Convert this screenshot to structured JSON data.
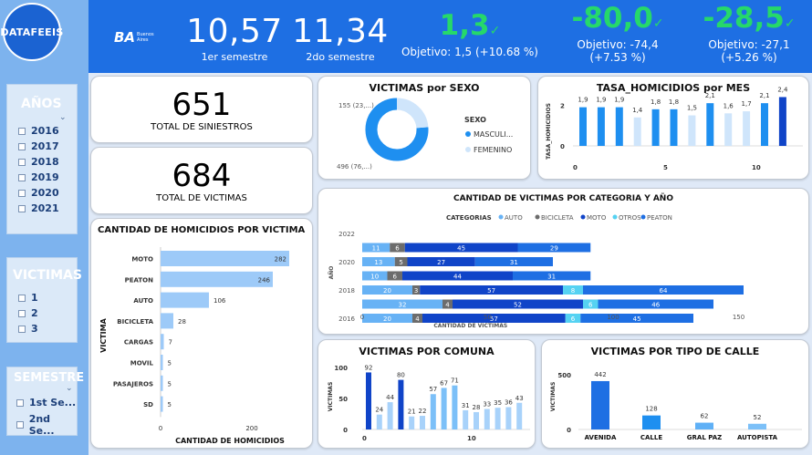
{
  "brand": {
    "logo_text": "DATAFEEIS",
    "ba_mark": "BA",
    "ba_caption": "Buenos Aires"
  },
  "colors": {
    "primary": "#1e6fe3",
    "accent_green": "#26d86a",
    "sidebar": "#7db3ee",
    "auto": "#67b2f5",
    "bicicleta": "#6c6c6c",
    "moto": "#1044c8",
    "otros": "#55d2f2",
    "peaton": "#1e6fe3"
  },
  "filters": {
    "years": {
      "title": "AÑOS",
      "items": [
        "2016",
        "2017",
        "2018",
        "2019",
        "2020",
        "2021"
      ]
    },
    "victims": {
      "title": "VICTIMAS",
      "items": [
        "1",
        "2",
        "3"
      ]
    },
    "semester": {
      "title": "SEMESTRE",
      "items": [
        "1st Se...",
        "2nd Se..."
      ]
    }
  },
  "kpis": {
    "sem1": {
      "value": "10,57",
      "label": "1er semestre"
    },
    "sem2": {
      "value": "11,34",
      "label": "2do semestre"
    },
    "k1": {
      "value": "1,3",
      "objective": "Objetivo: 1,5 (+10.68 %)"
    },
    "k2": {
      "value": "-80,0",
      "objective_line1": "Objetivo: -74,4",
      "objective_line2": "(+7.53 %)"
    },
    "k3": {
      "value": "-28,5",
      "objective_line1": "Objetivo: -27,1",
      "objective_line2": "(+5.26 %)"
    }
  },
  "totals": {
    "siniestros": {
      "value": "651",
      "label": "TOTAL DE SINIESTROS"
    },
    "victimas": {
      "value": "684",
      "label": "TOTAL DE VICTIMAS"
    }
  },
  "chart_data": [
    {
      "id": "sexo",
      "type": "pie",
      "title": "VICTIMAS por SEXO",
      "legend_title": "SEXO",
      "legend_placement": "right",
      "slices": [
        {
          "name": "MASCULI...",
          "value": 496,
          "label": "496 (76,...)",
          "color": "#1e8ff0"
        },
        {
          "name": "FEMENINO",
          "value": 155,
          "label": "155 (23,...)",
          "color": "#cfe5fb"
        }
      ]
    },
    {
      "id": "tasa",
      "type": "bar",
      "title": "TASA_HOMICIDIOS por MES",
      "ylabel": "TASA_HOMICIDIOS",
      "ylim": [
        0,
        2.6
      ],
      "y_ticks": [
        "0",
        "2"
      ],
      "x_ticks": [
        "0",
        "5",
        "10"
      ],
      "categories": [
        1,
        2,
        3,
        4,
        5,
        6,
        7,
        8,
        9,
        10,
        11,
        12
      ],
      "values": [
        1.9,
        1.9,
        1.9,
        1.4,
        1.8,
        1.8,
        1.5,
        2.1,
        1.6,
        1.7,
        2.1,
        2.4
      ],
      "labels": [
        "1,9",
        "1,9",
        "1,9",
        "1,4",
        "1,8",
        "1,8",
        "1,5",
        "2,1",
        "1,6",
        "1,7",
        "2,1",
        "2,4"
      ],
      "colors": [
        "#1e8ff0",
        "#1e8ff0",
        "#1e8ff0",
        "#cfe5fb",
        "#1e8ff0",
        "#1e8ff0",
        "#cfe5fb",
        "#1e8ff0",
        "#cfe5fb",
        "#cfe5fb",
        "#1e8ff0",
        "#1044c8"
      ]
    },
    {
      "id": "categoria",
      "type": "bar",
      "orientation": "horizontal",
      "stacked": true,
      "title": "CANTIDAD DE VICTIMAS POR CATEGORIA Y AÑO",
      "legend_title": "CATEGORIAS",
      "legend_placement": "top",
      "xlabel": "CANTIDAD DE VICTIMAS",
      "ylabel": "AÑO",
      "xlim": [
        0,
        160
      ],
      "x_ticks": [
        "0",
        "50",
        "100",
        "150"
      ],
      "categories": [
        "2022",
        "2021",
        "2020",
        "2019",
        "2018",
        "2017",
        "2016"
      ],
      "series": [
        {
          "name": "AUTO",
          "values": [
            0,
            11,
            13,
            10,
            20,
            32,
            20
          ],
          "color": "#67b2f5"
        },
        {
          "name": "BICICLETA",
          "values": [
            0,
            6,
            5,
            6,
            3,
            4,
            4
          ],
          "color": "#6c6c6c"
        },
        {
          "name": "MOTO",
          "values": [
            0,
            45,
            27,
            44,
            57,
            52,
            57
          ],
          "color": "#1044c8"
        },
        {
          "name": "OTROS",
          "values": [
            0,
            0,
            0,
            0,
            8,
            6,
            6
          ],
          "color": "#55d2f2"
        },
        {
          "name": "PEATON",
          "values": [
            0,
            29,
            31,
            31,
            64,
            46,
            45
          ],
          "color": "#1e6fe3"
        }
      ]
    },
    {
      "id": "homicidios",
      "type": "bar",
      "orientation": "horizontal",
      "title": "CANTIDAD DE HOMICIDIOS POR VICTIMA",
      "xlabel": "CANTIDAD DE HOMICIDIOS",
      "ylabel": "VICTIMA",
      "xlim": [
        0,
        300
      ],
      "x_ticks": [
        "0",
        "200"
      ],
      "categories": [
        "MOTO",
        "PEATON",
        "AUTO",
        "BICICLETA",
        "CARGAS",
        "MOVIL",
        "PASAJEROS",
        "SD"
      ],
      "values": [
        282,
        246,
        106,
        28,
        7,
        5,
        5,
        5
      ]
    },
    {
      "id": "comuna",
      "type": "bar",
      "title": "VICTIMAS POR COMUNA",
      "ylabel": "VICTIMAS",
      "ylim": [
        0,
        100
      ],
      "y_ticks": [
        "0",
        "50",
        "100"
      ],
      "x_ticks": [
        "0",
        "10"
      ],
      "categories": [
        1,
        2,
        3,
        4,
        5,
        6,
        7,
        8,
        9,
        10,
        11,
        12,
        13,
        14,
        15
      ],
      "values": [
        92,
        24,
        44,
        80,
        21,
        22,
        57,
        67,
        71,
        31,
        28,
        33,
        35,
        36,
        43
      ],
      "colors": [
        "#1044c8",
        "#a8d2fa",
        "#a8d2fa",
        "#1044c8",
        "#a8d2fa",
        "#a8d2fa",
        "#7cc0f8",
        "#7cc0f8",
        "#7cc0f8",
        "#a8d2fa",
        "#a8d2fa",
        "#a8d2fa",
        "#a8d2fa",
        "#a8d2fa",
        "#a8d2fa"
      ]
    },
    {
      "id": "calle",
      "type": "bar",
      "title": "VICTIMAS POR TIPO DE CALLE",
      "ylabel": "VICTIMAS",
      "ylim": [
        0,
        500
      ],
      "y_ticks": [
        "0",
        "500"
      ],
      "categories": [
        "AVENIDA",
        "CALLE",
        "GRAL PAZ",
        "AUTOPISTA"
      ],
      "values": [
        442,
        128,
        62,
        52
      ],
      "colors": [
        "#1e6fe3",
        "#1e8ff0",
        "#5fb0f6",
        "#7cc0f8"
      ]
    }
  ]
}
